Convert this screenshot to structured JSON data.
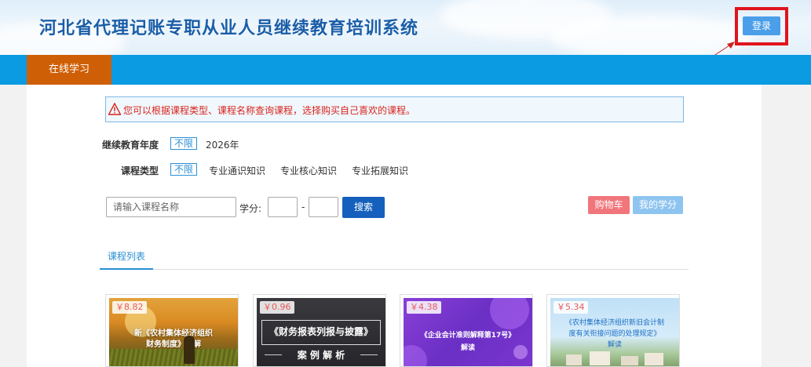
{
  "header": {
    "title": "河北省代理记账专职从业人员继续教育培训系统",
    "login_label": "登录"
  },
  "nav": {
    "tabs": [
      {
        "label": "在线学习"
      }
    ]
  },
  "notice": {
    "text": "您可以根据课程类型、课程名称查询课程，选择购买自己喜欢的课程。"
  },
  "filters": {
    "year": {
      "label": "继续教育年度",
      "options": [
        "不限",
        "2026年"
      ]
    },
    "type": {
      "label": "课程类型",
      "options": [
        "不限",
        "专业通识知识",
        "专业核心知识",
        "专业拓展知识"
      ]
    }
  },
  "search": {
    "placeholder": "请输入课程名称",
    "credit_label": "学分:",
    "dash": "-",
    "search_label": "搜索",
    "cart_label": "购物车",
    "my_credit_label": "我的学分"
  },
  "course_list": {
    "tab_label": "课程列表",
    "courses": [
      {
        "price": "￥8.82",
        "image_text": [
          "新《农村集体经济组织",
          "财务制度》讲解"
        ]
      },
      {
        "price": "￥0.96",
        "image_text": [
          "《财务报表列报与披露》",
          "案 例 解 析"
        ]
      },
      {
        "price": "￥4.38",
        "image_text": [
          "《企业会计准则解释第17号》",
          "解读"
        ]
      },
      {
        "price": "￥5.34",
        "image_text": [
          "《农村集体经济组织新旧会计制",
          "度有关衔接问题的处理规定》",
          "解读"
        ]
      }
    ]
  },
  "colors": {
    "nav_blue": "#0a9be3",
    "nav_tab_orange": "#cf5f06",
    "search_button": "#1560bd",
    "cart_button": "#f0767b",
    "credit_button": "#8ec4f0",
    "highlight_red": "#e0141d"
  }
}
